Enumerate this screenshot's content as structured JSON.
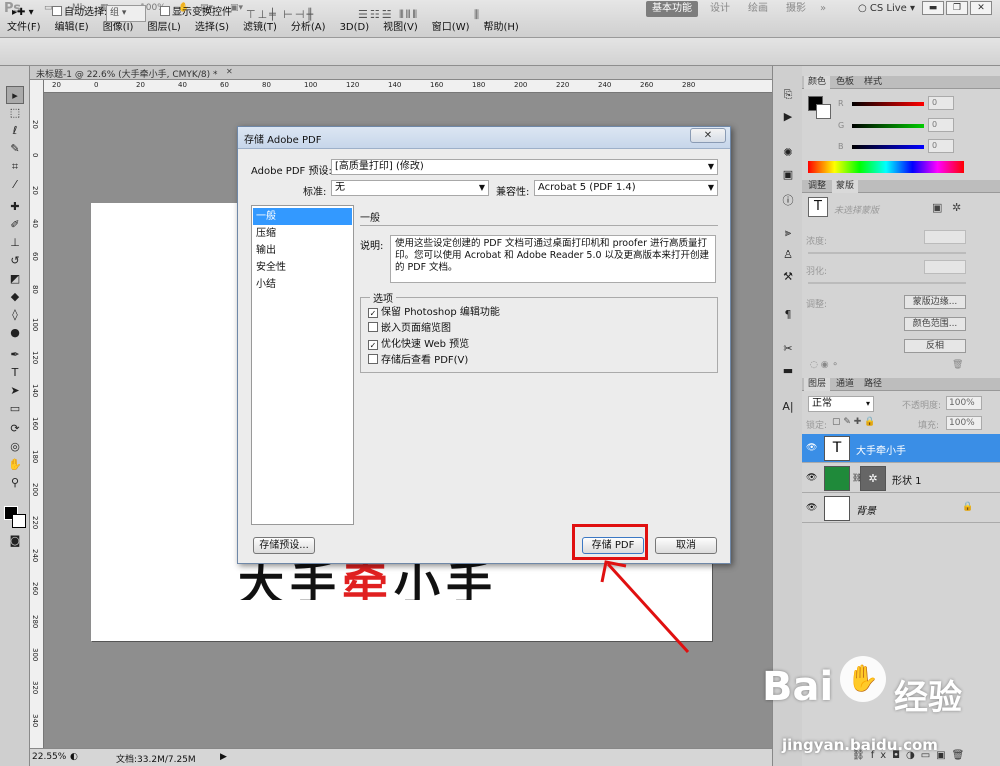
{
  "app": {
    "logo": "Ps"
  },
  "topbar": {
    "zoom": "100%",
    "workspaces": [
      "基本功能",
      "设计",
      "绘画",
      "摄影"
    ],
    "more": "»",
    "cslive": "CS Live"
  },
  "menu": [
    "文件(F)",
    "编辑(E)",
    "图像(I)",
    "图层(L)",
    "选择(S)",
    "滤镜(T)",
    "分析(A)",
    "3D(D)",
    "视图(V)",
    "窗口(W)",
    "帮助(H)"
  ],
  "options": {
    "auto_select_label": "自动选择:",
    "auto_select_value": "组",
    "show_transform_label": "显示变换控件"
  },
  "document": {
    "tab_title": "未标题-1 @ 22.6% (大手牵小手, CMYK/8) *",
    "ruler_h": [
      "20",
      "0",
      "20",
      "40",
      "60",
      "80",
      "100",
      "120",
      "140",
      "160",
      "180",
      "200",
      "220",
      "240",
      "260",
      "280"
    ],
    "ruler_v": [
      "20",
      "0",
      "20",
      "40",
      "60",
      "80",
      "100",
      "120",
      "140",
      "160",
      "180",
      "200",
      "220",
      "240",
      "260",
      "280",
      "300",
      "320",
      "340"
    ],
    "canvas_text_a": "大手",
    "canvas_text_b": "牵",
    "canvas_text_c": "小手"
  },
  "status": {
    "zoom": "22.55%",
    "doc_info": "文档:33.2M/7.25M"
  },
  "color_panel": {
    "tabs": [
      "颜色",
      "色板",
      "样式"
    ],
    "channels": [
      {
        "letter": "R",
        "value": "0"
      },
      {
        "letter": "G",
        "value": "0"
      },
      {
        "letter": "B",
        "value": "0"
      }
    ]
  },
  "adjust_panel": {
    "tabs": [
      "调整",
      "蒙版"
    ],
    "no_selection": "未选择蒙版",
    "density": "浓度:",
    "feather": "羽化:",
    "refine": "调整:",
    "mask_edge": "蒙版边缘...",
    "color_range": "颜色范围...",
    "invert": "反相"
  },
  "layers_panel": {
    "tabs": [
      "图层",
      "通道",
      "路径"
    ],
    "blend_mode": "正常",
    "opacity_label": "不透明度:",
    "opacity": "100%",
    "lock_label": "锁定:",
    "fill_label": "填充:",
    "fill": "100%",
    "layers": [
      {
        "name": "大手牵小手",
        "thumb": "T",
        "selected": true
      },
      {
        "name": "形状 1",
        "thumb": "",
        "selected": false
      },
      {
        "name": "背景",
        "thumb": "",
        "selected": false
      }
    ]
  },
  "dialog": {
    "title": "存储 Adobe PDF",
    "preset_label": "Adobe PDF 预设:",
    "preset_value": "[高质量打印] (修改)",
    "standard_label": "标准:",
    "standard_value": "无",
    "compat_label": "兼容性:",
    "compat_value": "Acrobat 5 (PDF 1.4)",
    "nav": [
      "一般",
      "压缩",
      "输出",
      "安全性",
      "小结"
    ],
    "section": "一般",
    "desc_label": "说明:",
    "description": "使用这些设定创建的 PDF 文档可通过桌面打印机和 proofer 进行高质量打印。您可以使用 Acrobat 和 Adobe Reader 5.0 以及更高版本来打开创建的 PDF 文档。",
    "options_legend": "选项",
    "options": [
      {
        "label": "保留 Photoshop 编辑功能",
        "checked": true
      },
      {
        "label": "嵌入页面缩览图",
        "checked": false
      },
      {
        "label": "优化快速 Web 预览",
        "checked": true
      },
      {
        "label": "存储后查看 PDF(V)",
        "checked": false
      }
    ],
    "save_preset": "存储预设...",
    "save_pdf": "存储 PDF",
    "cancel": "取消"
  },
  "watermark": {
    "brand": "Bai",
    "brand2": "经验",
    "url": "jingyan.baidu.com"
  }
}
